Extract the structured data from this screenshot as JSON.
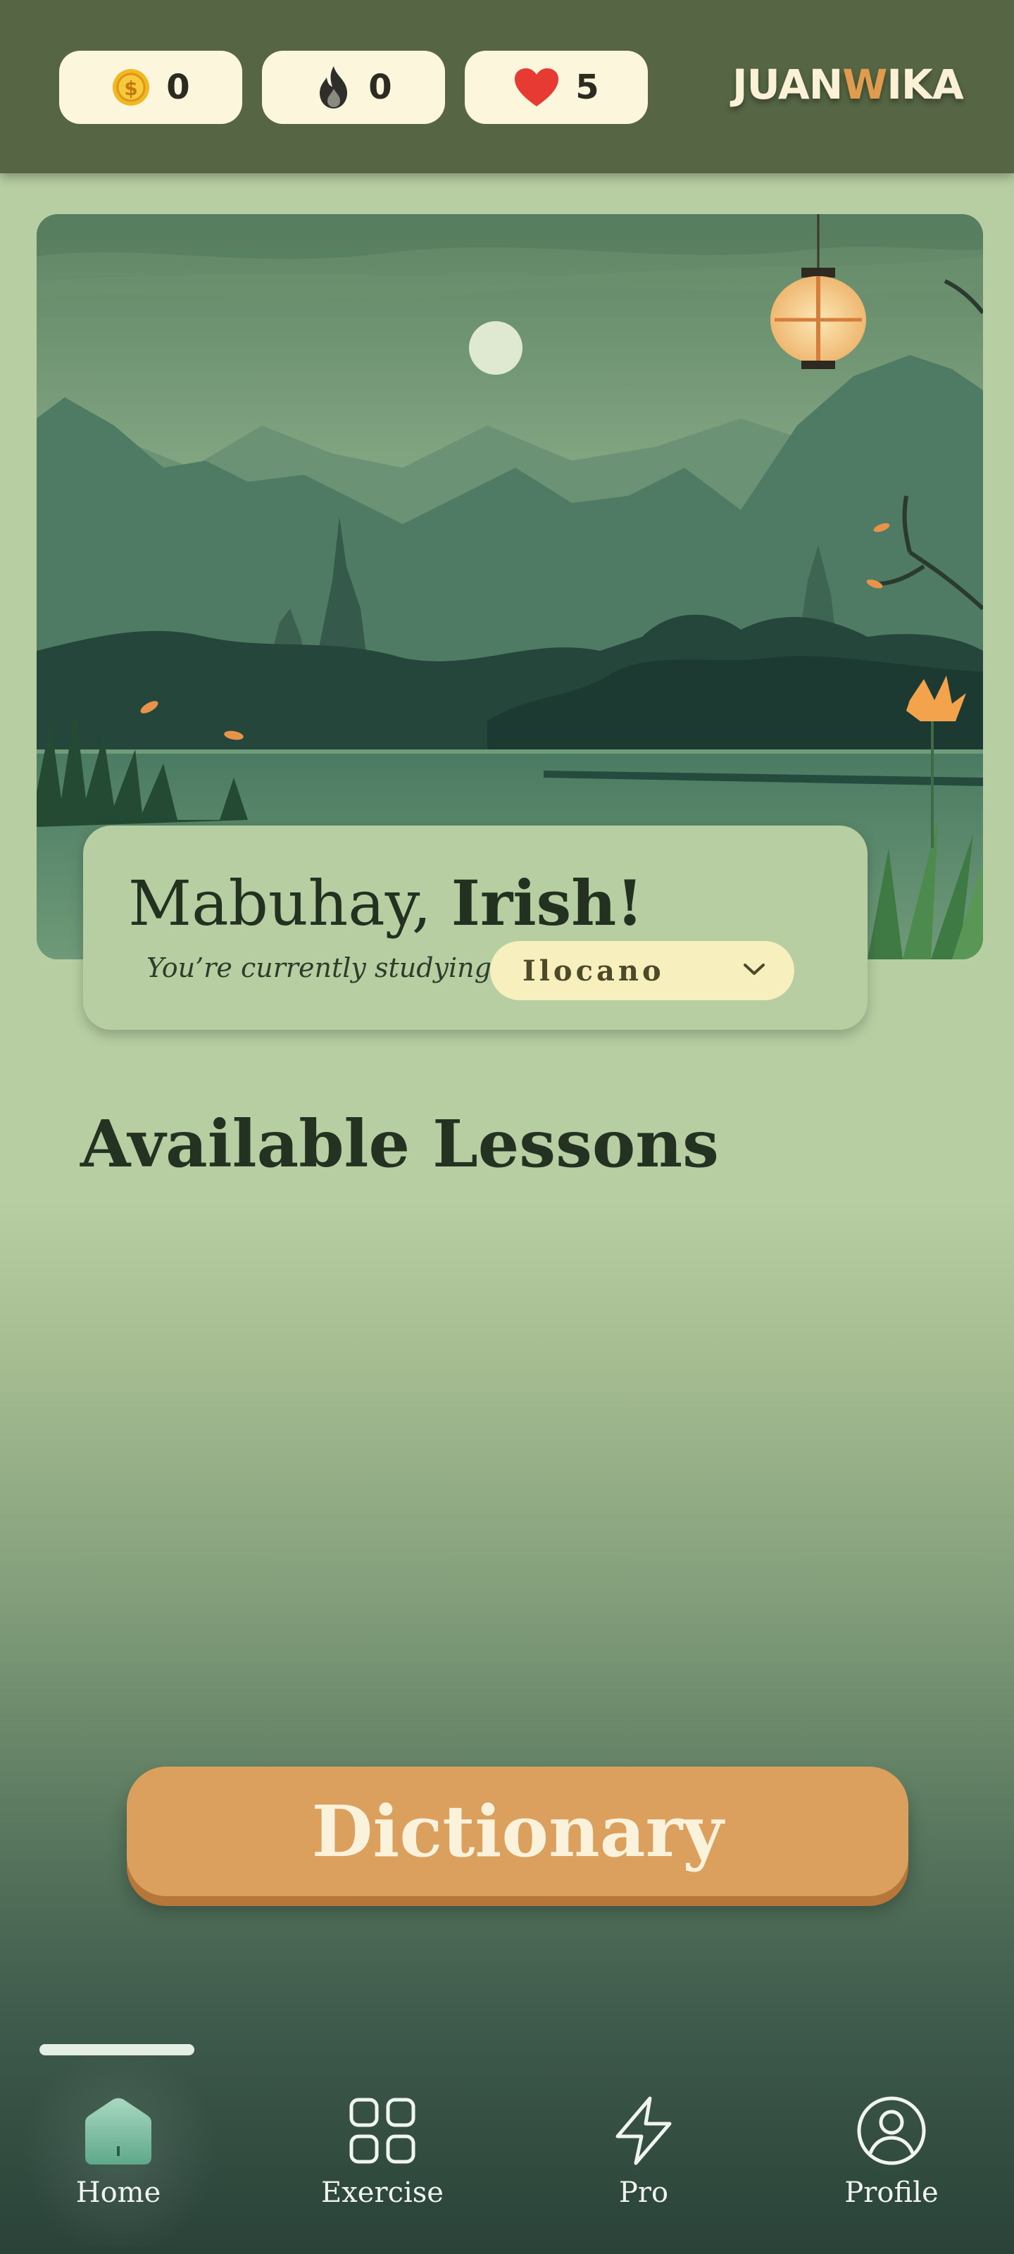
{
  "header": {
    "stats": {
      "coins": {
        "value": "0",
        "icon": "coin-icon",
        "color": "#f2b822"
      },
      "streak": {
        "value": "0",
        "icon": "fire-icon"
      },
      "hearts": {
        "value": "5",
        "icon": "heart-icon",
        "color": "#e63a32"
      }
    },
    "logo": {
      "prefix": "JUAN",
      "accent": "W",
      "suffix": "IKA",
      "accent_color": "#df9c4f"
    }
  },
  "hero": {
    "greeting_prefix": "Mabuhay,",
    "user_name": "Irish!",
    "studying_label": "You’re currently studying:",
    "language": "Ilocano",
    "dropdown_icon": "chevron-down-icon"
  },
  "main": {
    "section_title": "Available Lessons",
    "dictionary_button": "Dictionary",
    "accent_color": "#dba05e"
  },
  "nav": {
    "active": "Home",
    "items": [
      {
        "label": "Home",
        "icon": "home-icon"
      },
      {
        "label": "Exercise",
        "icon": "grid-icon"
      },
      {
        "label": "Pro",
        "icon": "lightning-icon"
      },
      {
        "label": "Profile",
        "icon": "user-icon"
      }
    ]
  }
}
